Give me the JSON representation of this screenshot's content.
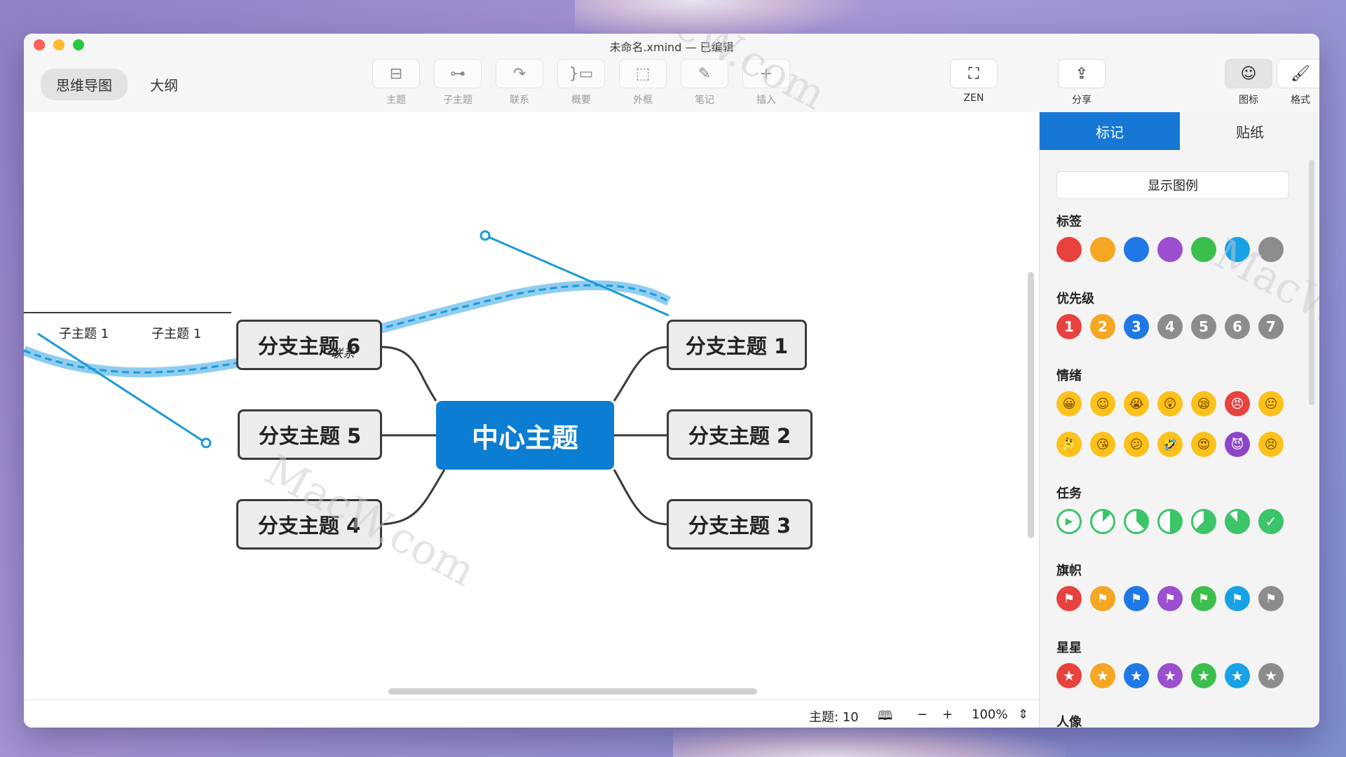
{
  "window": {
    "title": "未命名.xmind — 已编辑"
  },
  "view_tabs": [
    {
      "label": "思维导图",
      "active": true
    },
    {
      "label": "大纲",
      "active": false
    }
  ],
  "toolbar": {
    "topic": "主题",
    "subtopic": "子主题",
    "relationship": "联系",
    "summary": "概要",
    "boundary": "外框",
    "notes": "笔记",
    "insert": "插入",
    "zen": "ZEN",
    "share": "分享",
    "icon": "图标",
    "format": "格式"
  },
  "canvas": {
    "central": "中心主题",
    "branches": [
      "分支主题 1",
      "分支主题 2",
      "分支主题 3",
      "分支主题 4",
      "分支主题 5",
      "分支主题 6"
    ],
    "relationship_label": "联系",
    "subtopics": [
      "子主题 1",
      "子主题 1"
    ]
  },
  "status": {
    "topic_count": "主题: 10",
    "zoom": "100%",
    "zoom_out": "−",
    "zoom_in": "+"
  },
  "sidebar": {
    "tabs": [
      {
        "label": "标记",
        "active": true
      },
      {
        "label": "贴纸",
        "active": false
      }
    ],
    "legend_button": "显示图例",
    "sections": {
      "tags": "标签",
      "priority": "优先级",
      "mood": "情绪",
      "task": "任务",
      "flags": "旗帜",
      "stars": "星星",
      "people": "人像"
    },
    "tag_colors": [
      "#e8423f",
      "#f5a623",
      "#1f78e6",
      "#9b4fd0",
      "#3bbf4c",
      "#17a2e6",
      "#8c8c8c"
    ],
    "priority_numbers": [
      "1",
      "2",
      "3",
      "4",
      "5",
      "6",
      "7"
    ],
    "priority_colors": [
      "#e8423f",
      "#f5a623",
      "#1f78e6",
      "#8c8c8c",
      "#8c8c8c",
      "#8c8c8c",
      "#8c8c8c"
    ],
    "moods_row1": [
      "grinning",
      "smile",
      "crying",
      "astonished",
      "sleepy",
      "angry",
      "neutral"
    ],
    "moods_row2": [
      "thinking",
      "kissing",
      "confused",
      "rofl",
      "heart-eyes",
      "devil",
      "persevere"
    ],
    "task_progress": [
      0,
      0.125,
      0.375,
      0.5,
      0.625,
      0.875,
      1
    ],
    "flag_colors": [
      "#e8423f",
      "#f5a623",
      "#1f78e6",
      "#9b4fd0",
      "#3bbf4c",
      "#17a2e6",
      "#8c8c8c"
    ],
    "star_colors": [
      "#e8423f",
      "#f5a623",
      "#1f78e6",
      "#9b4fd0",
      "#3bbf4c",
      "#17a2e6",
      "#8c8c8c"
    ]
  }
}
